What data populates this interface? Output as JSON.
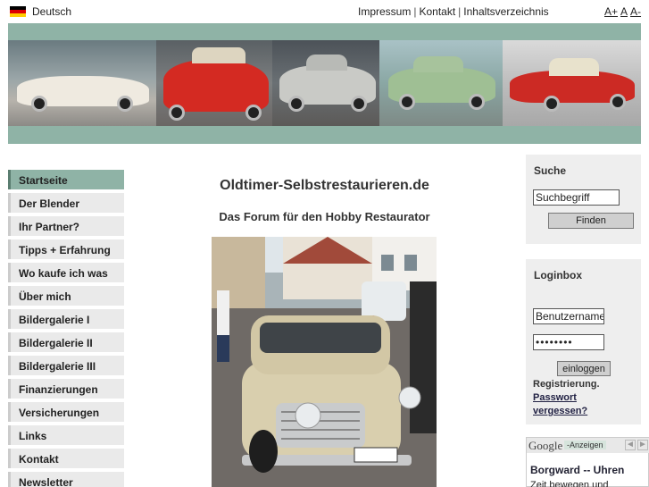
{
  "topbar": {
    "language": "Deutsch",
    "links": [
      "Impressum",
      "Kontakt",
      "Inhaltsverzeichnis"
    ],
    "separator": "|",
    "font_size_controls": [
      "A+",
      "A",
      "A-"
    ]
  },
  "banner": {
    "background_color": "#8fb3a6",
    "photos": [
      {
        "icon": "white-convertible-car-image"
      },
      {
        "icon": "red-convertible-car-image"
      },
      {
        "icon": "silver-sedan-car-image"
      },
      {
        "icon": "green-sedan-car-image"
      },
      {
        "icon": "red-coupe-car-image"
      }
    ]
  },
  "sidebar": {
    "items": [
      {
        "label": "Startseite",
        "active": true
      },
      {
        "label": "Der Blender"
      },
      {
        "label": "Ihr Partner?"
      },
      {
        "label": "Tipps + Erfahrung"
      },
      {
        "label": "Wo kaufe ich was"
      },
      {
        "label": "Über mich"
      },
      {
        "label": "Bildergalerie I"
      },
      {
        "label": "Bildergalerie II"
      },
      {
        "label": "Bildergalerie III"
      },
      {
        "label": "Finanzierungen"
      },
      {
        "label": "Versicherungen"
      },
      {
        "label": "Links"
      },
      {
        "label": "Kontakt"
      },
      {
        "label": "Newsletter"
      }
    ]
  },
  "main": {
    "title": "Oldtimer-Selbstrestaurieren.de",
    "subtitle": "Das Forum für den Hobby Restaurator",
    "photo_icon": "beige-vintage-sedan-photo"
  },
  "search": {
    "title": "Suche",
    "input_value": "Suchbegriff",
    "button_label": "Finden"
  },
  "login": {
    "title": "Loginbox",
    "username_value": "Benutzername",
    "password_mask": "••••••••",
    "button_label": "einloggen",
    "register_label": "Registrierung.",
    "forgot_label_1": "Passwort",
    "forgot_label_2": "vergessen?"
  },
  "ad": {
    "logo": "Google",
    "tag": "-Anzeigen",
    "arrows": [
      "◄",
      "►"
    ],
    "title": "Borgward -- Uhren",
    "text": "Zeit bewegen und"
  },
  "colors": {
    "accent": "#8fb3a6",
    "nav_bg": "#eaeaea",
    "box_bg": "#eeeeee"
  }
}
